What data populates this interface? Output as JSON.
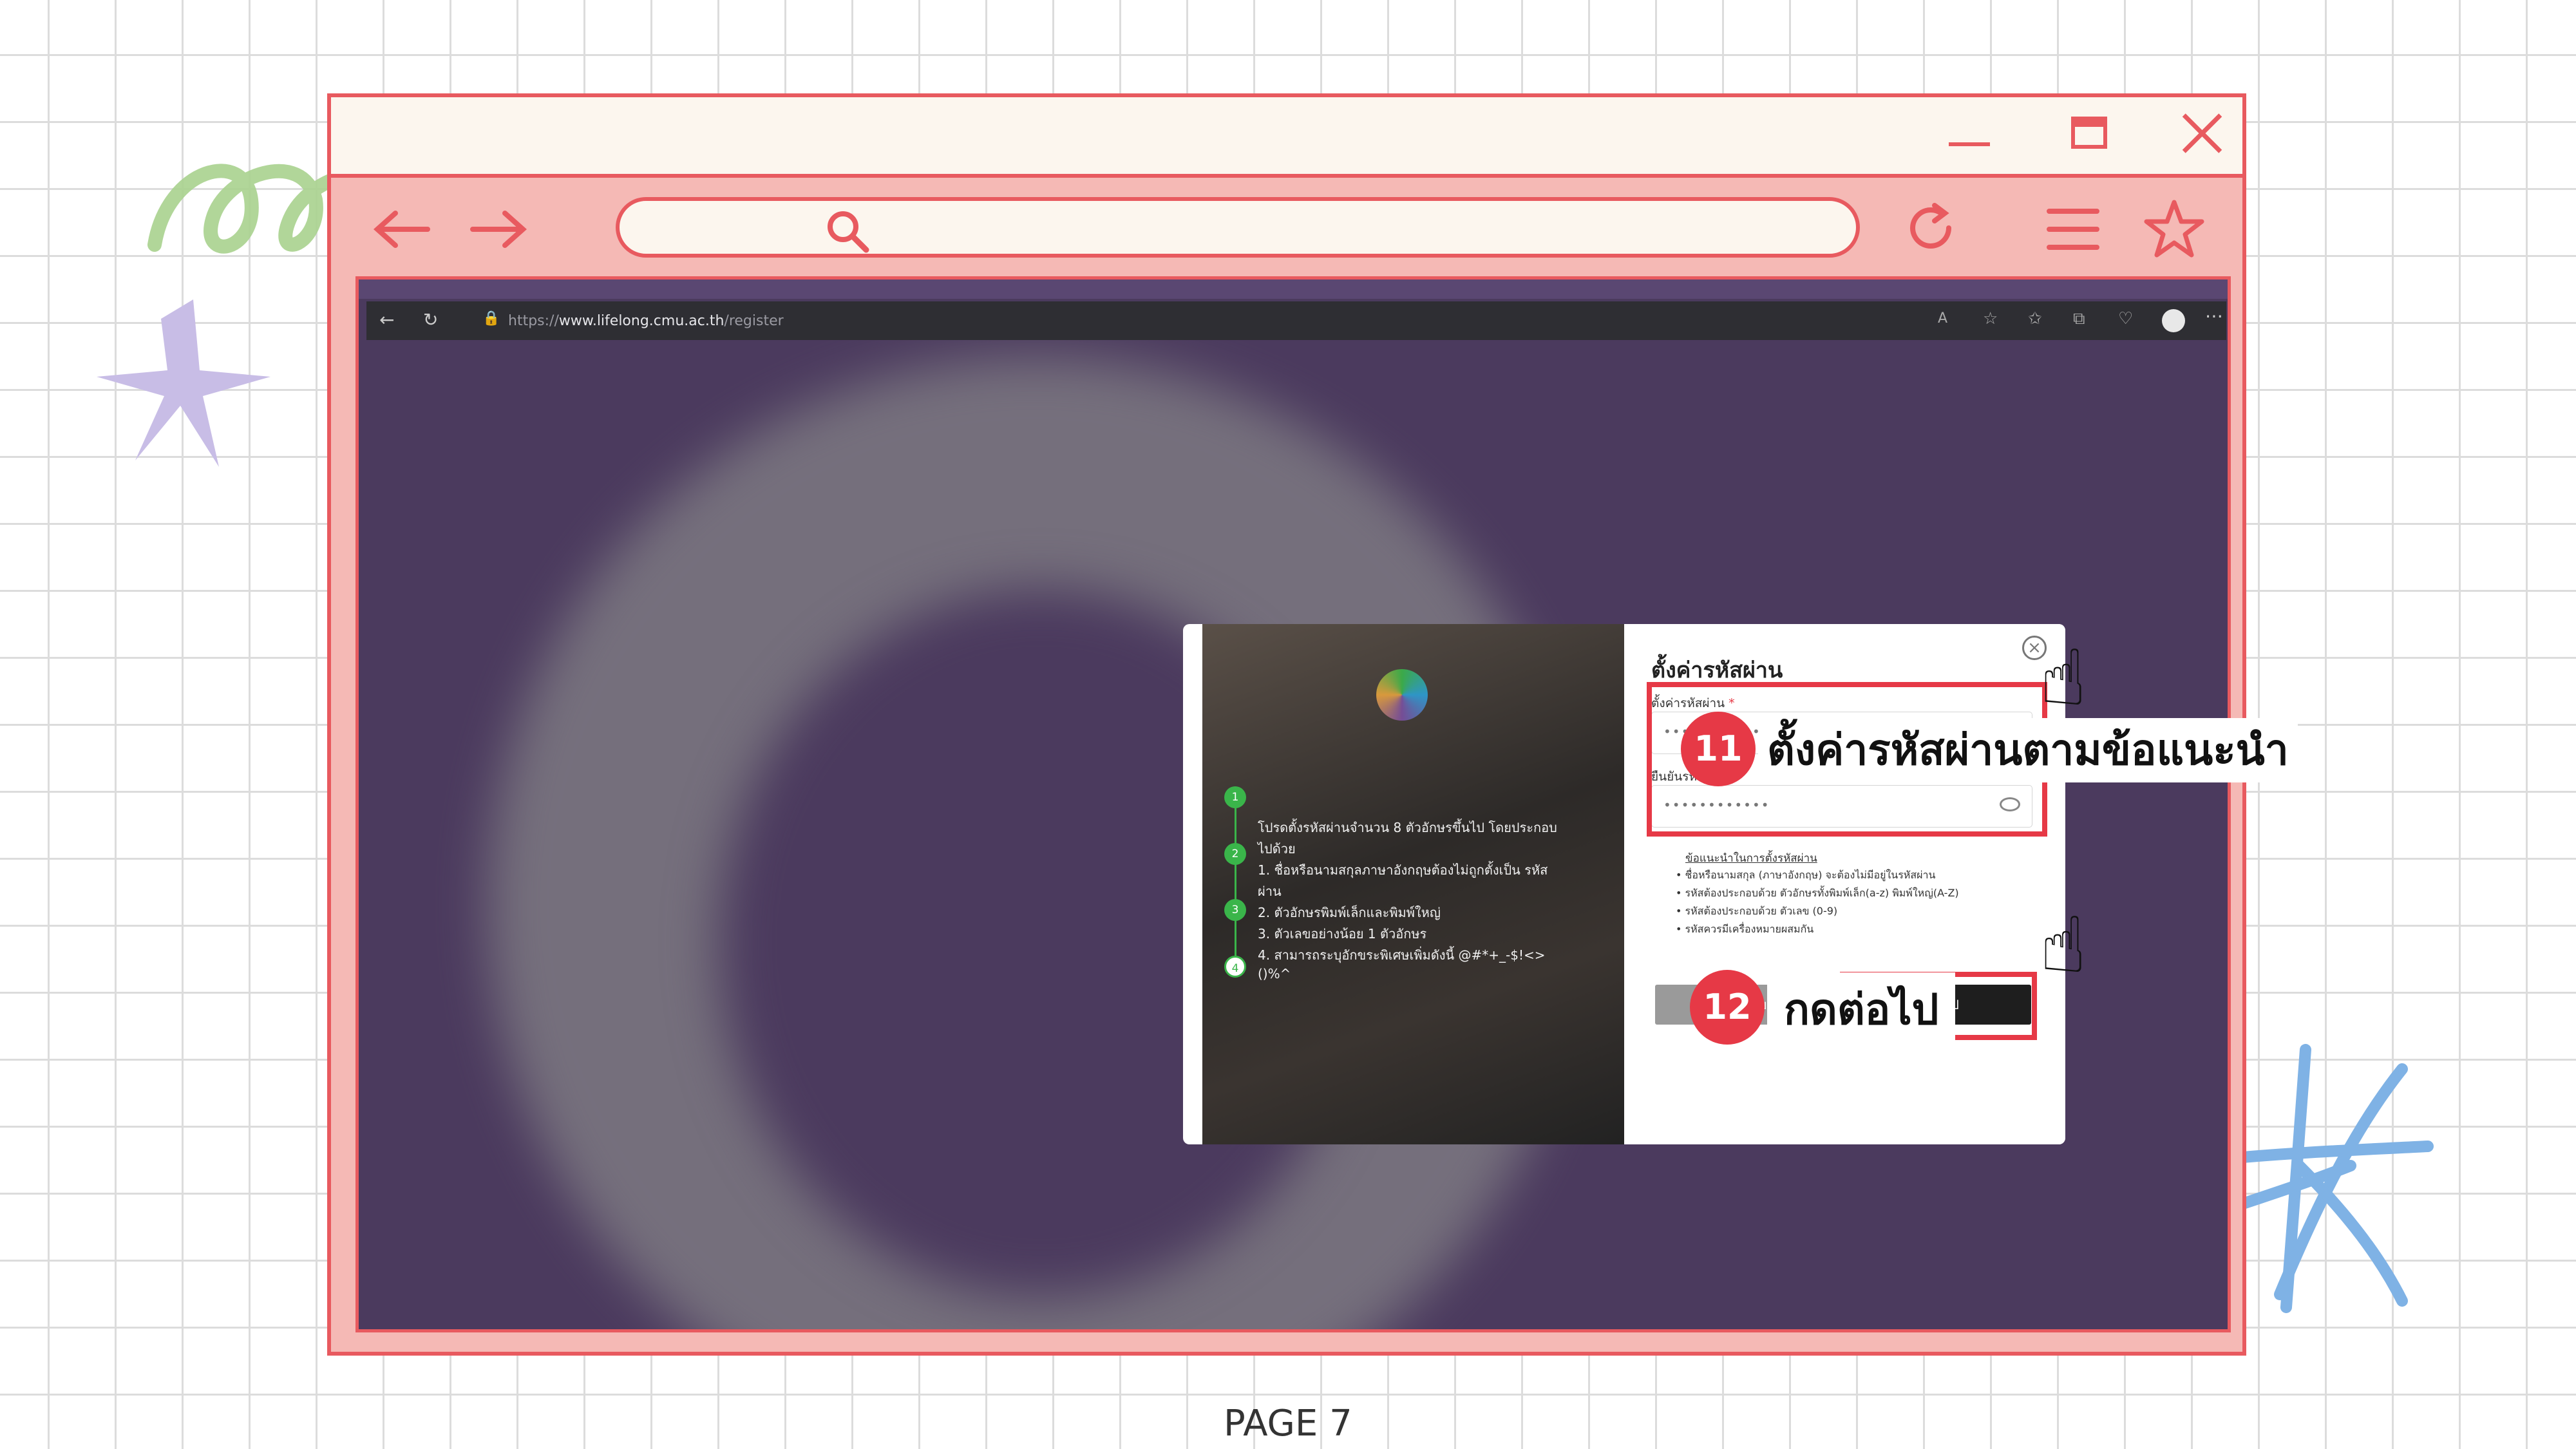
{
  "browser": {
    "address_placeholder": "",
    "nav_back": "←",
    "nav_forward": "→"
  },
  "inner_browser": {
    "url_prefix": "https://",
    "url_domain": "www.lifelong.cmu.ac.th",
    "url_path": "/register"
  },
  "modal": {
    "title": "ตั้งค่ารหัสผ่าน",
    "password_label": "ตั้งค่ารหัสผ่าน",
    "password_value": "••••••••••••",
    "confirm_label": "ยืนยันรหัสผ่าน",
    "confirm_value": "••••••••••••",
    "required_mark": "*",
    "hints_title": "ข้อแนะนำในการตั้งรหัสผ่าน",
    "hints": [
      "ชื่อหรือนามสกุล (ภาษาอังกฤษ) จะต้องไม่มีอยู่ในรหัสผ่าน",
      "รหัสต้องประกอบด้วย ตัวอักษรทั้งพิมพ์เล็ก(a-z) พิมพ์ใหญ่(A-Z)",
      "รหัสต้องประกอบด้วย ตัวเลข (0-9)",
      "รหัสควรมีเครื่องหมายผสมกัน"
    ],
    "back_button": "ย้อนกลับ",
    "next_button": "ต่อไป",
    "steps": [
      "1",
      "2",
      "3",
      "4"
    ],
    "left_text": [
      "โปรดตั้งรหัสผ่านจำนวน 8 ตัวอักษรขึ้นไป โดยประกอบ",
      "ไปด้วย",
      "1.  ชื่อหรือนามสกุลภาษาอังกฤษต้องไม่ถูกตั้งเป็น  รหัส",
      "ผ่าน",
      "2. ตัวอักษรพิมพ์เล็กและพิมพ์ใหญ่",
      "3. ตัวเลขอย่างน้อย 1 ตัวอักษร",
      "4.    สามารถระบุอักขระพิเศษเพิ่มดังนี้    @#*+_-$!<>",
      "()%^"
    ]
  },
  "callouts": [
    {
      "number": "11",
      "text": "ตั้งค่ารหัสผ่านตามข้อแนะนำ"
    },
    {
      "number": "12",
      "text": "กดต่อไป"
    }
  ],
  "page_label": "PAGE 7",
  "colors": {
    "frame_red": "#e85a5f",
    "frame_pink": "#f5b9b5",
    "badge_red": "#e63946",
    "step_green": "#3ab54a",
    "bg_purple": "#4b3a5e"
  }
}
